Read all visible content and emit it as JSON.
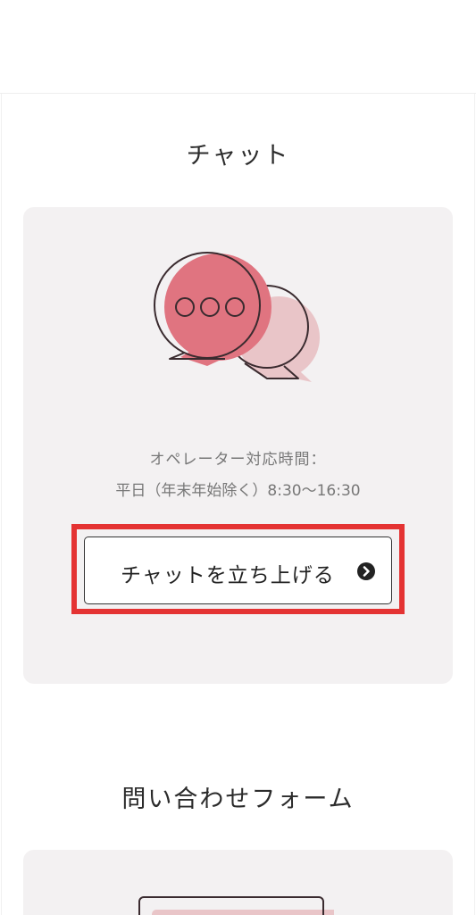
{
  "chat_section": {
    "title": "チャット",
    "illustration": "chat-bubbles-icon",
    "hours_label": "オペレーター対応時間：",
    "hours_value": "平日（年末年始除く）8:30〜16:30",
    "button_label": "チャットを立ち上げる",
    "button_icon": "chevron-right-circle-icon"
  },
  "form_section": {
    "title": "問い合わせフォーム",
    "illustration": "form-window-icon"
  },
  "colors": {
    "accent": "#e07480",
    "accent_light": "#e9c5c8",
    "highlight": "#e43333",
    "card_background": "#f3f1f2",
    "text": "#2b2b2b",
    "muted_text": "#777777"
  }
}
